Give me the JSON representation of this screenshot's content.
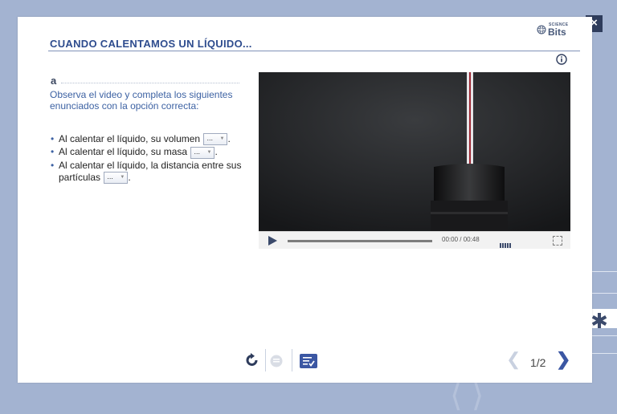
{
  "header": {
    "title": "CUANDO CALENTAMOS UN LÍQUIDO...",
    "logo_small": "SCIENCE",
    "logo_big": "Bits",
    "close_label": "×"
  },
  "question": {
    "letter": "a",
    "instruction": "Observa el video y completa los siguientes enunciados con la opción correcta:",
    "items": [
      {
        "text_before": "Al calentar el líquido, su volumen",
        "dropdown_value": "...",
        "text_after": "."
      },
      {
        "text_before": "Al calentar el líquido, su masa",
        "dropdown_value": "...",
        "text_after": "."
      },
      {
        "text_before": "Al calentar el líquido, la distancia entre sus partículas",
        "dropdown_value": "...",
        "text_after": "."
      }
    ]
  },
  "video": {
    "time": "00:00 / 00:48",
    "progress": 0
  },
  "footer": {
    "page": "1/2"
  },
  "icons": [
    "close-icon",
    "info-icon",
    "science-bits-logo",
    "play-icon",
    "volume-icon",
    "fullscreen-icon",
    "reload-icon",
    "comment-icon",
    "checklist-icon",
    "chevron-left-icon",
    "chevron-right-icon",
    "asterisk-icon"
  ],
  "colors": {
    "accent": "#2e4c8e",
    "instruction": "#3d62a3",
    "background": "#a3b3d1",
    "dark": "#2e3c5c"
  }
}
